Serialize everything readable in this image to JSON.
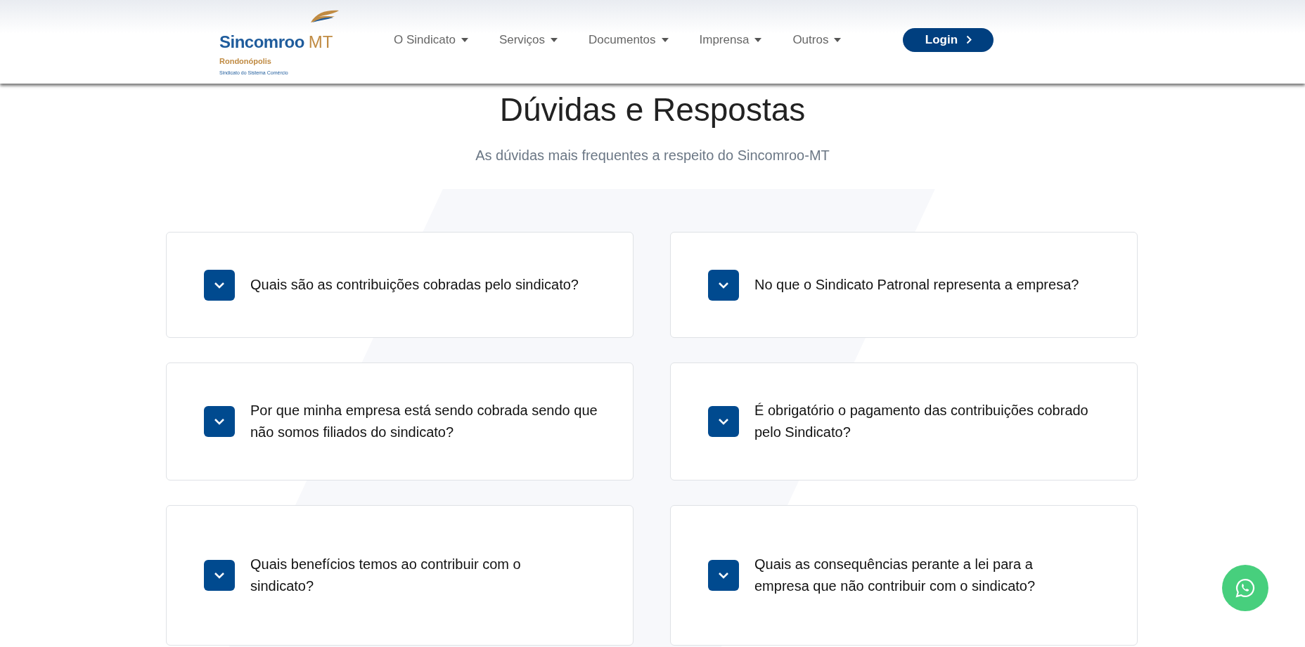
{
  "logo": {
    "name": "Sincomroo",
    "suffix": "MT",
    "city": "Rondonópolis",
    "tagline": "Sindicato do Sistema Comércio"
  },
  "nav": [
    {
      "label": "O Sindicato"
    },
    {
      "label": "Serviços"
    },
    {
      "label": "Documentos"
    },
    {
      "label": "Imprensa"
    },
    {
      "label": "Outros"
    }
  ],
  "login": {
    "label": "Login"
  },
  "heading": "Dúvidas e Respostas",
  "subheading": "As dúvidas mais frequentes a respeito do Sincomroo-MT",
  "faq": [
    {
      "question": "Quais são as contribuições cobradas pelo sindicato?",
      "expanded": false
    },
    {
      "question": "No que o Sindicato Patronal representa a empresa?",
      "expanded": false
    },
    {
      "question": "Por que minha empresa está sendo cobrada sendo que não somos filiados do sindicato?",
      "expanded": false
    },
    {
      "question": "É obrigatório o pagamento das contribuições cobrado pelo Sindicato?",
      "expanded": false
    },
    {
      "question": "Quais benefícios temos ao contribuir com o sindicato?",
      "expanded": false
    },
    {
      "question": "Quais as consequências perante a lei para a empresa que não contribuir com o sindicato?",
      "expanded": false
    }
  ]
}
